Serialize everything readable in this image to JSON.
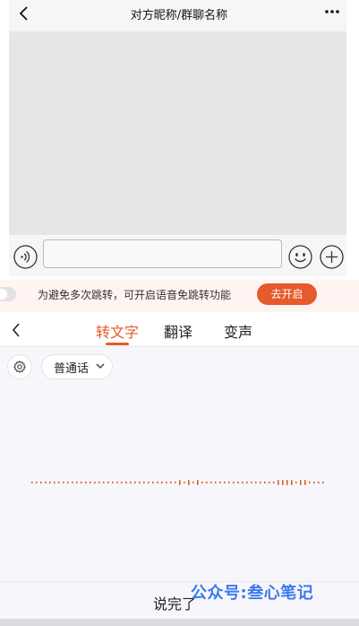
{
  "chat": {
    "title": "对方昵称/群聊名称"
  },
  "banner": {
    "text": "为避免多次跳转，可开启语音免跳转功能",
    "button_label": "去开启"
  },
  "voice_panel": {
    "tabs": [
      {
        "label": "转文字",
        "active": true
      },
      {
        "label": "翻译",
        "active": false
      },
      {
        "label": "变声",
        "active": false
      }
    ],
    "language_selected": "普通话",
    "done_label": "说完了"
  },
  "watermark": "公众号:叁心笔记",
  "colors": {
    "accent": "#e65a2b",
    "watermark": "#3b78f0"
  },
  "icons": [
    "back-icon",
    "more-icon",
    "voice-icon",
    "emoji-icon",
    "plus-icon",
    "gear-icon",
    "chevron-down-icon"
  ]
}
